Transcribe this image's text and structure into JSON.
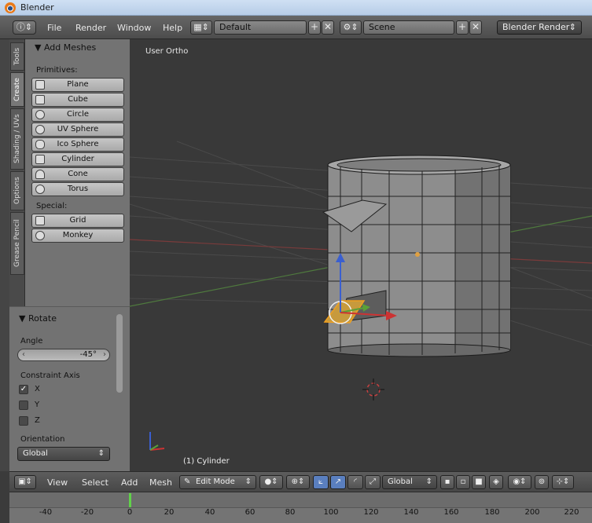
{
  "window": {
    "title": "Blender"
  },
  "info_header": {
    "editor_icon": "info-icon",
    "menus": [
      "File",
      "Render",
      "Window",
      "Help"
    ],
    "screen_layout": "Default",
    "scene": "Scene",
    "render_engine": "Blender Render",
    "add_symbol": "+",
    "close_symbol": "✕"
  },
  "tool_tabs": [
    "Tools",
    "Create",
    "Shading / UVs",
    "Options",
    "Grease Pencil"
  ],
  "add_meshes": {
    "title": "▼ Add Meshes",
    "primitives_label": "Primitives:",
    "primitives": [
      "Plane",
      "Cube",
      "Circle",
      "UV Sphere",
      "Ico Sphere",
      "Cylinder",
      "Cone",
      "Torus"
    ],
    "special_label": "Special:",
    "special": [
      "Grid",
      "Monkey"
    ]
  },
  "rotate_panel": {
    "title": "▼ Rotate",
    "angle_label": "Angle",
    "angle_value": "-45°",
    "constraint_label": "Constraint Axis",
    "axes": [
      {
        "label": "X",
        "checked": true,
        "mark": "✓"
      },
      {
        "label": "Y",
        "checked": false,
        "mark": ""
      },
      {
        "label": "Z",
        "checked": false,
        "mark": ""
      }
    ],
    "orientation_label": "Orientation",
    "orientation_value": "Global"
  },
  "viewport": {
    "view_name": "User Ortho",
    "object_label": "(1) Cylinder",
    "axis_colors": {
      "x": "#cc3333",
      "y": "#5aa037",
      "z": "#3a5fd0"
    }
  },
  "view3d_header": {
    "menus": [
      "View",
      "Select",
      "Add",
      "Mesh"
    ],
    "mode": "Edit Mode",
    "orientation": "Global"
  },
  "timeline": {
    "current_frame": 0,
    "ticks": [
      "-40",
      "-20",
      "0",
      "20",
      "40",
      "60",
      "80",
      "100",
      "120",
      "140",
      "160",
      "180",
      "200",
      "220"
    ]
  }
}
